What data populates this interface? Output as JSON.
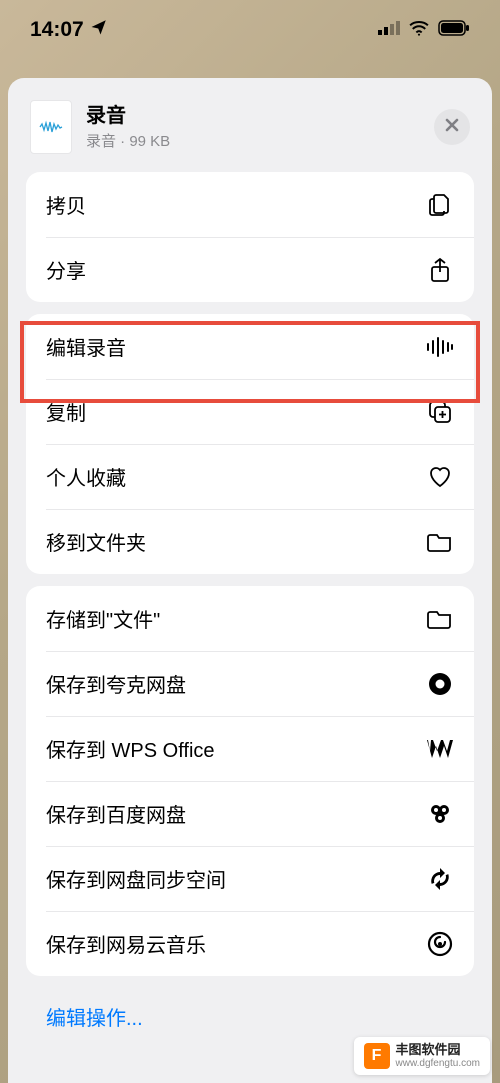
{
  "status": {
    "time": "14:07"
  },
  "header": {
    "title": "录音",
    "subtitle": "录音 · 99 KB"
  },
  "group1": {
    "copy": "拷贝",
    "share": "分享"
  },
  "group2": {
    "edit_recording": "编辑录音",
    "duplicate": "复制",
    "favorite": "个人收藏",
    "move_folder": "移到文件夹"
  },
  "group3": {
    "save_files": "存储到\"文件\"",
    "save_quark": "保存到夸克网盘",
    "save_wps": "保存到 WPS Office",
    "save_baidu": "保存到百度网盘",
    "save_sync": "保存到网盘同步空间",
    "save_netease": "保存到网易云音乐"
  },
  "edit_actions": "编辑操作...",
  "watermark": {
    "title": "丰图软件园",
    "url": "www.dgfengtu.com"
  }
}
